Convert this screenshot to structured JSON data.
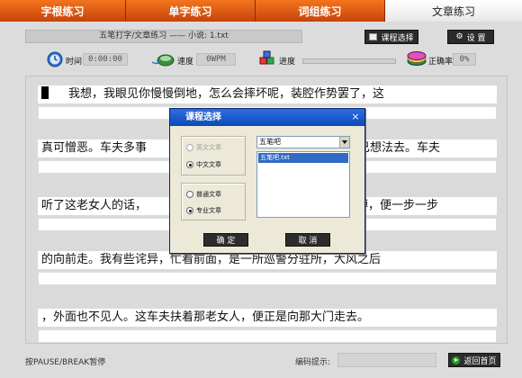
{
  "tabs": [
    {
      "label": "字根练习",
      "active": false
    },
    {
      "label": "单字练习",
      "active": false
    },
    {
      "label": "词组练习",
      "active": false
    },
    {
      "label": "文章练习",
      "active": true
    }
  ],
  "file_bar": "五笔打字/文章练习 —— 小说: 1.txt",
  "toolbar": {
    "course_button": "课程选择",
    "settings_button": "设  置"
  },
  "stats": {
    "time_label": "时间",
    "time_value": "0:00:00",
    "speed_label": "速度",
    "speed_value": "0WPM",
    "progress_label": "进度",
    "progress_fraction": 0.0,
    "accuracy_label": "正确率",
    "accuracy_value": "0%"
  },
  "lines": [
    "我想，我眼见你慢慢倒地，怎么会摔坏呢，装腔作势罢了，这",
    "真可憎恶。车夫多事",
    "听了这老女人的话，",
    "的向前走。我有些诧异，忙看前面，是一所巡警分驻所，大风之后",
    "，外面也不见人。这车夫扶着那老女人，便正是向那大门走去。"
  ],
  "lines_right": [
    "",
    "已想法去。车夫",
    "膊，便一步一步",
    "",
    ""
  ],
  "bottom": {
    "pause_hint": "按PAUSE/BREAK暂停",
    "code_hint_label": "编码提示:",
    "home_button": "返回首页"
  },
  "dialog": {
    "title": "课程选择",
    "close": "×",
    "lang_group": [
      {
        "label": "英文文章",
        "checked": false,
        "disabled": true
      },
      {
        "label": "中文文章",
        "checked": true,
        "disabled": false
      }
    ],
    "type_group": [
      {
        "label": "普通文章",
        "checked": false
      },
      {
        "label": "专业文章",
        "checked": true
      }
    ],
    "combo_value": "五笔吧",
    "list_items": [
      "五笔吧.txt"
    ],
    "ok": "确 定",
    "cancel": "取 消"
  },
  "colors": {
    "tab_orange": "#e4601a",
    "title_blue": "#0a4ab8",
    "selection_blue": "#316ac5"
  }
}
